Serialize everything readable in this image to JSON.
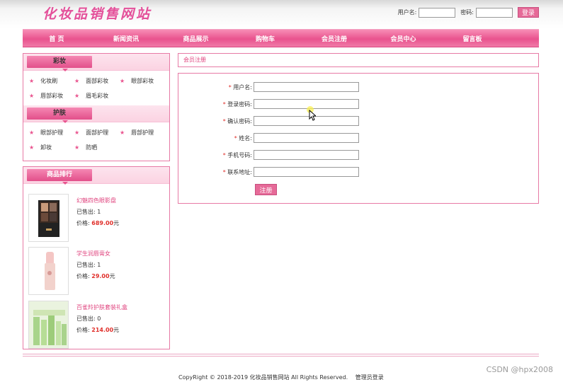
{
  "header": {
    "logo": "化妆品销售网站",
    "username_label": "用户名:",
    "password_label": "密码:",
    "login_button": "登录"
  },
  "nav": [
    {
      "label": "首 页"
    },
    {
      "label": "新闻资讯"
    },
    {
      "label": "商品展示"
    },
    {
      "label": "购物车"
    },
    {
      "label": "会员注册"
    },
    {
      "label": "会员中心"
    },
    {
      "label": "留言板"
    }
  ],
  "sidebar": {
    "makeup": {
      "title": "彩妆",
      "items": [
        "化妆刷",
        "面部彩妆",
        "眼部彩妆",
        "唇部彩妆",
        "眉毛彩妆"
      ]
    },
    "skincare": {
      "title": "护肤",
      "items": [
        "眼部护理",
        "面部护理",
        "唇部护理",
        "卸妆",
        "防晒"
      ]
    },
    "ranking": {
      "title": "商品排行",
      "sold_label": "已售出:",
      "price_label": "价格:",
      "currency": "元",
      "products": [
        {
          "name": "幻魅四色眼影盘",
          "sold": "1",
          "price": "689.00"
        },
        {
          "name": "学生润唇膏女",
          "sold": "1",
          "price": "29.00"
        },
        {
          "name": "百雀羚护肤套装礼盒",
          "sold": "0",
          "price": "214.00"
        }
      ]
    }
  },
  "main": {
    "section_title": "会员注册",
    "fields": [
      {
        "label": "用户名:",
        "required": "*"
      },
      {
        "label": "登录密码:",
        "required": "*"
      },
      {
        "label": "确认密码:",
        "required": "*"
      },
      {
        "label": "姓名:",
        "required": "*"
      },
      {
        "label": "手机号码:",
        "required": "*"
      },
      {
        "label": "联系地址:",
        "required": "*"
      }
    ],
    "submit_button": "注册"
  },
  "footer": {
    "copyright": "CopyRight © 2018-2019 化妆品销售网站 All Rights Reserved.",
    "admin_link": "管理员登录"
  },
  "watermark": "CSDN @hpx2008",
  "colors": {
    "accent": "#e9538e",
    "price": "#e0302b",
    "border": "#e77aa5"
  }
}
